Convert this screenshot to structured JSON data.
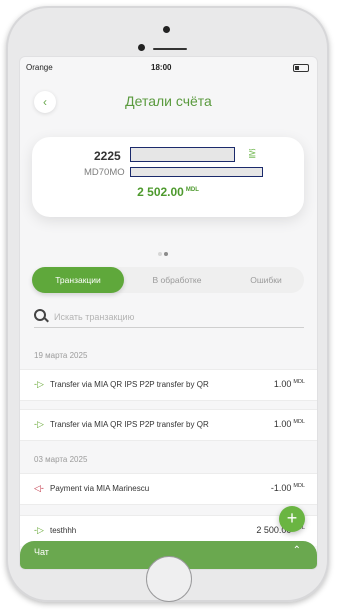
{
  "status_bar": {
    "carrier": "Orange",
    "time": "18:00"
  },
  "header": {
    "title": "Детали счёта",
    "back_icon": "chevron-left-icon"
  },
  "account": {
    "number_prefix": "2225",
    "iban_prefix": "MD70MO",
    "balance": "2 502.00",
    "currency": "MDL"
  },
  "tabs": [
    {
      "label": "Транзакции",
      "active": true
    },
    {
      "label": "В обработке",
      "active": false
    },
    {
      "label": "Ошибки",
      "active": false
    }
  ],
  "search": {
    "placeholder": "Искать транзакцию"
  },
  "groups": [
    {
      "date": "19 марта 2025",
      "items": [
        {
          "label": "Transfer via MIA QR IPS P2P transfer by QR",
          "amount": "1.00",
          "currency": "MDL",
          "direction": "in"
        },
        {
          "label": "Transfer via MIA QR IPS P2P transfer by QR",
          "amount": "1.00",
          "currency": "MDL",
          "direction": "in"
        }
      ]
    },
    {
      "date": "03 марта 2025",
      "items": [
        {
          "label": "Payment via MIA Marinescu",
          "amount": "-1.00",
          "currency": "MDL",
          "direction": "out"
        },
        {
          "label": "testhhh",
          "amount": "2 500.00",
          "currency": "MDL",
          "direction": "in"
        }
      ]
    }
  ],
  "chat": {
    "label": "Чат"
  },
  "colors": {
    "accent": "#5fa83b",
    "outgoing": "#c23a4a"
  }
}
